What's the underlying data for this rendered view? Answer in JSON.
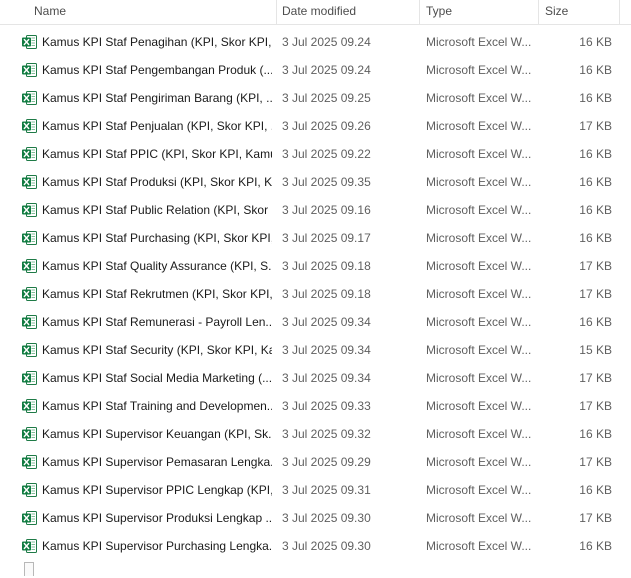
{
  "columns": {
    "name": "Name",
    "date_modified": "Date modified",
    "type": "Type",
    "size": "Size",
    "sort_indicator": "^"
  },
  "icons": {
    "file": "excel-file-icon",
    "excel_green": "#107c41"
  },
  "files": [
    {
      "name": "Kamus KPI Staf Penagihan (KPI, Skor KPI, ...",
      "date": "3 Jul 2025 09.24",
      "type": "Microsoft Excel W...",
      "size": "16 KB"
    },
    {
      "name": "Kamus KPI Staf Pengembangan Produk (...",
      "date": "3 Jul 2025 09.24",
      "type": "Microsoft Excel W...",
      "size": "16 KB"
    },
    {
      "name": "Kamus KPI Staf Pengiriman Barang (KPI, ...",
      "date": "3 Jul 2025 09.25",
      "type": "Microsoft Excel W...",
      "size": "16 KB"
    },
    {
      "name": "Kamus KPI Staf Penjualan (KPI, Skor KPI, ...",
      "date": "3 Jul 2025 09.26",
      "type": "Microsoft Excel W...",
      "size": "17 KB"
    },
    {
      "name": "Kamus KPI Staf PPIC (KPI, Skor KPI, Kamu...",
      "date": "3 Jul 2025 09.22",
      "type": "Microsoft Excel W...",
      "size": "16 KB"
    },
    {
      "name": "Kamus KPI Staf Produksi (KPI, Skor KPI, K...",
      "date": "3 Jul 2025 09.35",
      "type": "Microsoft Excel W...",
      "size": "16 KB"
    },
    {
      "name": "Kamus KPI Staf Public Relation (KPI, Skor ...",
      "date": "3 Jul 2025 09.16",
      "type": "Microsoft Excel W...",
      "size": "16 KB"
    },
    {
      "name": "Kamus KPI Staf Purchasing (KPI, Skor KPI,...",
      "date": "3 Jul 2025 09.17",
      "type": "Microsoft Excel W...",
      "size": "16 KB"
    },
    {
      "name": "Kamus KPI Staf Quality Assurance (KPI, S...",
      "date": "3 Jul 2025 09.18",
      "type": "Microsoft Excel W...",
      "size": "17 KB"
    },
    {
      "name": "Kamus KPI Staf Rekrutmen (KPI, Skor KPI,...",
      "date": "3 Jul 2025 09.18",
      "type": "Microsoft Excel W...",
      "size": "17 KB"
    },
    {
      "name": "Kamus KPI Staf Remunerasi - Payroll Len...",
      "date": "3 Jul 2025 09.34",
      "type": "Microsoft Excel W...",
      "size": "16 KB"
    },
    {
      "name": "Kamus KPI Staf Security (KPI, Skor KPI, Ka...",
      "date": "3 Jul 2025 09.34",
      "type": "Microsoft Excel W...",
      "size": "15 KB"
    },
    {
      "name": "Kamus KPI Staf Social Media Marketing (...",
      "date": "3 Jul 2025 09.34",
      "type": "Microsoft Excel W...",
      "size": "17 KB"
    },
    {
      "name": "Kamus KPI Staf Training and Developmen...",
      "date": "3 Jul 2025 09.33",
      "type": "Microsoft Excel W...",
      "size": "17 KB"
    },
    {
      "name": "Kamus KPI Supervisor Keuangan (KPI, Sk...",
      "date": "3 Jul 2025 09.32",
      "type": "Microsoft Excel W...",
      "size": "16 KB"
    },
    {
      "name": "Kamus KPI Supervisor Pemasaran Lengka...",
      "date": "3 Jul 2025 09.29",
      "type": "Microsoft Excel W...",
      "size": "17 KB"
    },
    {
      "name": "Kamus KPI Supervisor PPIC Lengkap (KPI,...",
      "date": "3 Jul 2025 09.31",
      "type": "Microsoft Excel W...",
      "size": "16 KB"
    },
    {
      "name": "Kamus KPI Supervisor Produksi Lengkap ...",
      "date": "3 Jul 2025 09.30",
      "type": "Microsoft Excel W...",
      "size": "17 KB"
    },
    {
      "name": "Kamus KPI Supervisor Purchasing Lengka...",
      "date": "3 Jul 2025 09.30",
      "type": "Microsoft Excel W...",
      "size": "16 KB"
    }
  ]
}
